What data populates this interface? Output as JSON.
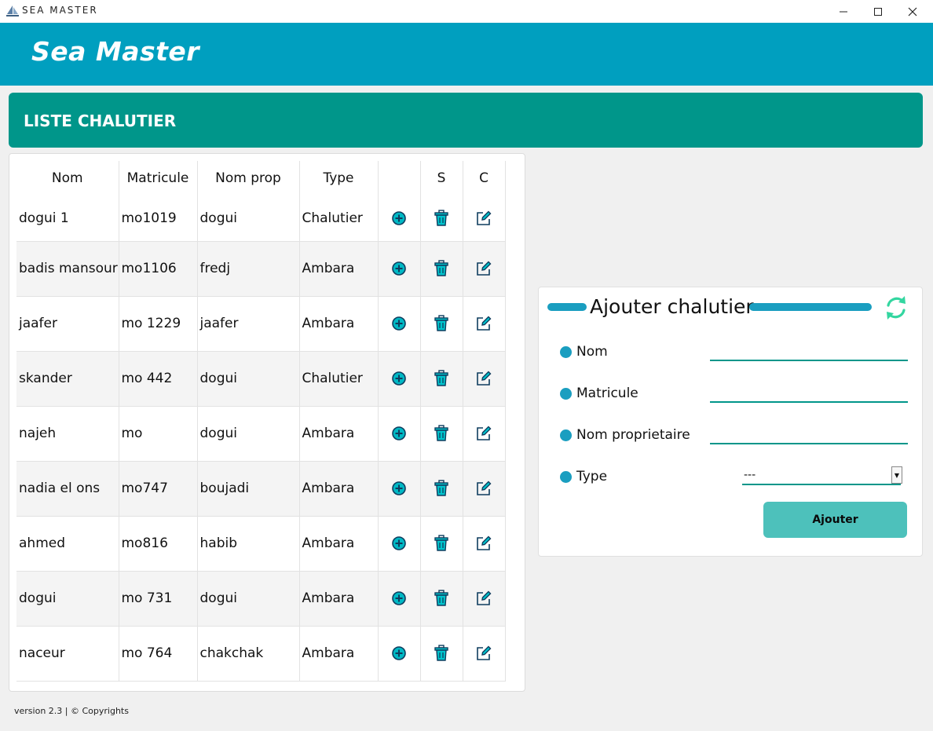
{
  "window": {
    "title": "SEA MASTER",
    "controls": {
      "minimize": "–",
      "maximize": "☐",
      "close": "✕"
    }
  },
  "header": {
    "brand": "Sea Master"
  },
  "section": {
    "title": "LISTE CHALUTIER"
  },
  "table": {
    "columns": [
      "Nom",
      "Matricule",
      "Nom prop",
      "Type",
      "",
      "S",
      "C"
    ],
    "rows": [
      {
        "nom": "dogui 1",
        "matricule": "mo1019",
        "nom_prop": "dogui",
        "type": "Chalutier"
      },
      {
        "nom": "badis mansour",
        "matricule": "mo1106",
        "nom_prop": "fredj",
        "type": "Ambara"
      },
      {
        "nom": "jaafer",
        "matricule": "mo 1229",
        "nom_prop": "jaafer",
        "type": "Ambara"
      },
      {
        "nom": "skander",
        "matricule": "mo 442",
        "nom_prop": "dogui",
        "type": "Chalutier"
      },
      {
        "nom": "najeh",
        "matricule": "mo",
        "nom_prop": "dogui",
        "type": "Ambara"
      },
      {
        "nom": "nadia el ons",
        "matricule": "mo747",
        "nom_prop": "boujadi",
        "type": "Ambara"
      },
      {
        "nom": "ahmed",
        "matricule": "mo816",
        "nom_prop": "habib",
        "type": "Ambara"
      },
      {
        "nom": "dogui",
        "matricule": "mo 731",
        "nom_prop": "dogui",
        "type": "Ambara"
      },
      {
        "nom": "naceur",
        "matricule": "mo 764",
        "nom_prop": "chakchak",
        "type": "Ambara"
      }
    ],
    "row_icons": [
      "plus-circle-icon",
      "trash-icon",
      "edit-icon"
    ]
  },
  "form": {
    "title": "Ajouter chalutier",
    "fields": {
      "nom": {
        "label": "Nom",
        "value": ""
      },
      "matricule": {
        "label": "Matricule",
        "value": ""
      },
      "nom_proprietaire": {
        "label": "Nom proprietaire",
        "value": ""
      },
      "type": {
        "label": "Type",
        "selected": "---"
      }
    },
    "submit_label": "Ajouter",
    "refresh_icon": "refresh-icon"
  },
  "footer": {
    "text": "version 2.3 | © Copyrights"
  },
  "colors": {
    "header": "#009fbf",
    "section_bar": "#00968a",
    "accent_blue": "#1a9ec0",
    "button": "#4dc1bb",
    "icon_teal": "#00c4cc",
    "refresh_green": "#33d6a0"
  }
}
